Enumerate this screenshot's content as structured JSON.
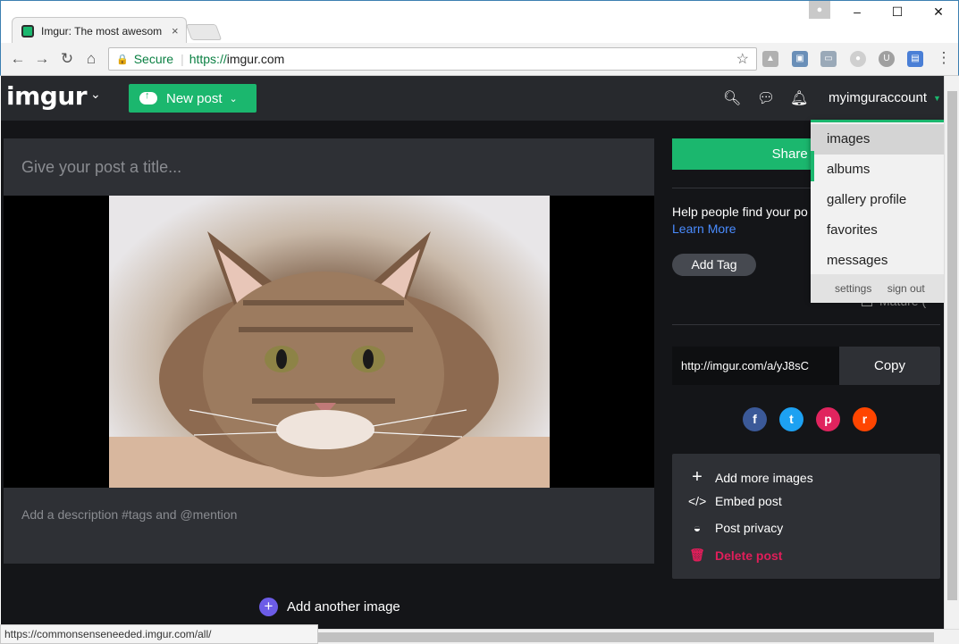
{
  "browser": {
    "tab_title": "Imgur: The most awesom",
    "tab_close": "×",
    "secure_label": "Secure",
    "url_scheme": "https://",
    "url_host": "imgur.com",
    "status_url": "https://commonsenseneeded.imgur.com/all/",
    "window_controls": [
      "–",
      "☐",
      "✕"
    ]
  },
  "header": {
    "logo": "imgur",
    "new_post_label": "New post",
    "account_name": "myimguraccount"
  },
  "editor": {
    "title_placeholder": "Give your post a title...",
    "description_placeholder": "Add a description #tags and @mention",
    "add_another_label": "Add another image"
  },
  "sidebar": {
    "share_label": "Share to co",
    "help_text": "Help people find your po",
    "learn_more": "Learn More",
    "add_tag": "Add Tag",
    "mature_label": "Mature (",
    "post_link": "http://imgur.com/a/yJ8sC",
    "copy_label": "Copy",
    "social": [
      {
        "name": "facebook",
        "glyph": "f",
        "color": "#3b5998"
      },
      {
        "name": "twitter",
        "glyph": "t",
        "color": "#1da1f2"
      },
      {
        "name": "pinterest",
        "glyph": "p",
        "color": "#e0245e"
      },
      {
        "name": "reddit",
        "glyph": "r",
        "color": "#ff4500"
      }
    ],
    "actions": [
      {
        "label": "Add more images",
        "icon": "plus-icon"
      },
      {
        "label": "Embed post",
        "icon": "code-icon"
      },
      {
        "label": "Post privacy",
        "icon": "mask-icon"
      },
      {
        "label": "Delete post",
        "icon": "trash-icon"
      }
    ]
  },
  "dropdown": {
    "items": [
      "images",
      "albums",
      "gallery profile",
      "favorites",
      "messages"
    ],
    "settings": "settings",
    "sign_out": "sign out"
  },
  "colors": {
    "accent": "#1bb76e",
    "background": "#141518",
    "panel": "#2e3035",
    "danger": "#e01e5a",
    "link": "#4a8cff"
  }
}
